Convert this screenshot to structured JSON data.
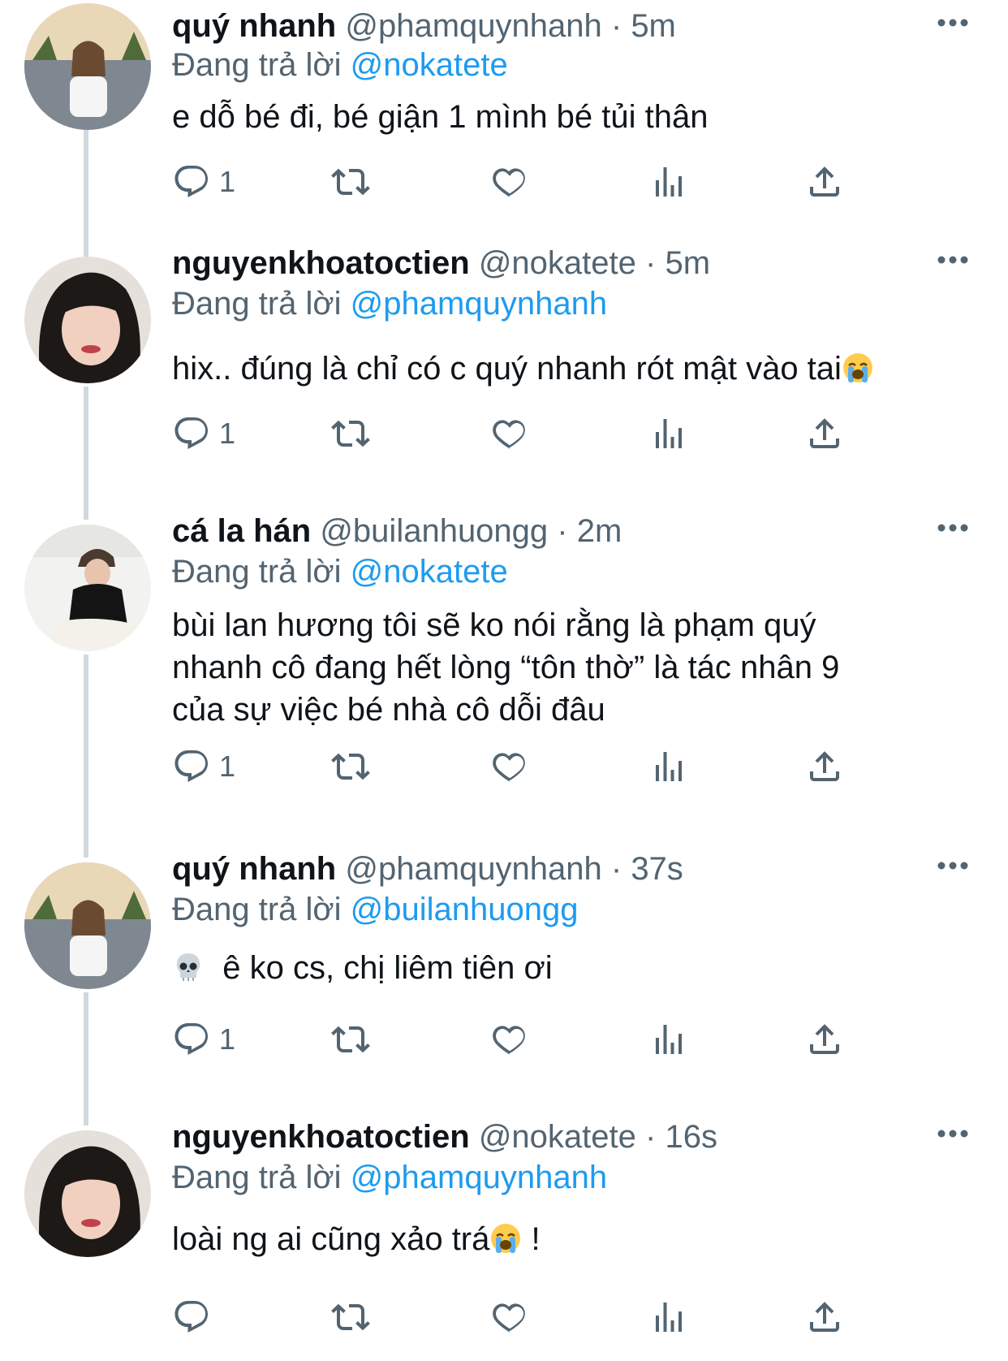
{
  "colors": {
    "accent": "#1d9bf0",
    "secondary_text": "#536471",
    "thread_line": "#cfd9de"
  },
  "tweets": [
    {
      "name": "quý nhanh",
      "handle": "@phamquynhanh",
      "dot": "·",
      "time": "5m",
      "reply_prefix": "Đang trả lời",
      "reply_to": "@nokatete",
      "lines": [
        "e dỗ bé đi, bé giận 1 mình bé tủi thân"
      ],
      "reply_count": "1",
      "avatar_icon": "avatar-photo-street"
    },
    {
      "name": "nguyenkhoatoctien",
      "handle": "@nokatete",
      "dot": "·",
      "time": "5m",
      "reply_prefix": "Đang trả lời",
      "reply_to": "@phamquynhanh",
      "lines": [
        "hix.. đúng là chỉ có c quý nhanh rót mật vào tai"
      ],
      "trailing_emoji": "loudly-crying-face-emoji",
      "reply_count": "1",
      "avatar_icon": "avatar-photo-portrait"
    },
    {
      "name": "cá la hán",
      "handle": "@builanhuongg",
      "dot": "·",
      "time": "2m",
      "reply_prefix": "Đang trả lời",
      "reply_to": "@nokatete",
      "lines": [
        "bùi lan hương tôi sẽ ko nói rằng là phạm quý",
        "nhanh cô đang hết lòng “tôn thờ” là tác nhân 9",
        "của sự việc bé nhà cô dỗi đâu"
      ],
      "reply_count": "1",
      "avatar_icon": "avatar-photo-cap"
    },
    {
      "name": "quý nhanh",
      "handle": "@phamquynhanh",
      "dot": "·",
      "time": "37s",
      "reply_prefix": "Đang trả lời",
      "reply_to": "@builanhuongg",
      "lines": [
        "ê ko cs, chị liêm tiên ơi"
      ],
      "leading_emoji": "skull-emoji",
      "reply_count": "1",
      "avatar_icon": "avatar-photo-street"
    },
    {
      "name": "nguyenkhoatoctien",
      "handle": "@nokatete",
      "dot": "·",
      "time": "16s",
      "reply_prefix": "Đang trả lời",
      "reply_to": "@phamquynhanh",
      "lines": [
        "loài ng ai cũng xảo trá",
        " !"
      ],
      "inline_emoji": "loudly-crying-face-emoji",
      "reply_count": "",
      "avatar_icon": "avatar-photo-portrait"
    }
  ]
}
